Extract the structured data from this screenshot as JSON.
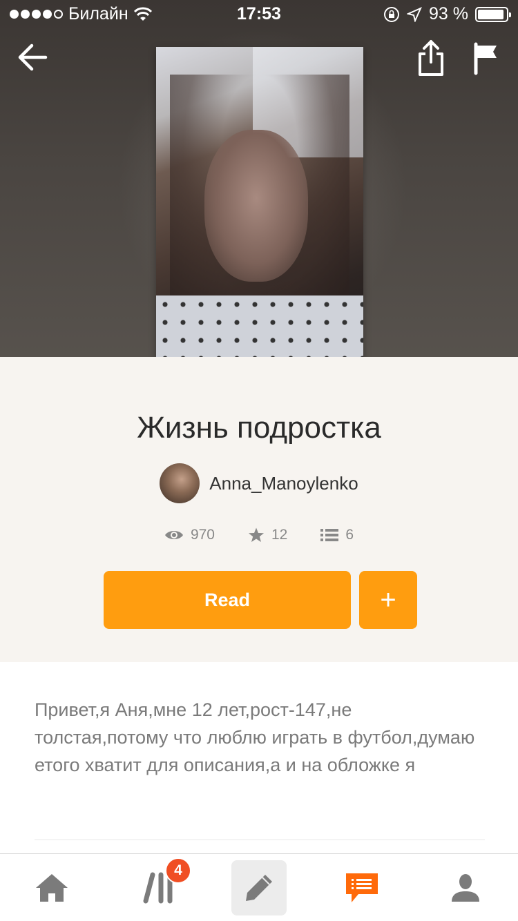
{
  "status_bar": {
    "carrier": "Билайн",
    "time": "17:53",
    "battery": "93 %",
    "battery_level": 0.93,
    "signal_bars_filled": 4,
    "signal_bars_total": 5
  },
  "header": {
    "back_icon": "arrow-left-icon",
    "share_icon": "share-icon",
    "flag_icon": "flag-icon"
  },
  "story": {
    "title": "Жизнь подростка",
    "author": "Anna_Manoylenko",
    "views": "970",
    "votes": "12",
    "parts": "6"
  },
  "actions": {
    "read_label": "Read",
    "add_label": "+"
  },
  "description": "Привет,я Аня,мне 12 лет,рост-147,не толстая,потому что люблю играть в футбол,думаю етого хватит для описания,а и на обложке я",
  "tabbar": {
    "items": [
      {
        "name": "home",
        "icon": "home-icon"
      },
      {
        "name": "library",
        "icon": "library-icon",
        "badge": "4"
      },
      {
        "name": "write",
        "icon": "pencil-icon"
      },
      {
        "name": "messages",
        "icon": "chat-icon"
      },
      {
        "name": "profile",
        "icon": "user-icon"
      }
    ]
  },
  "colors": {
    "accent": "#ff9d0f",
    "badge": "#f04e23",
    "info_bg": "#f7f4f0",
    "messages_active": "#ff6a0a"
  }
}
